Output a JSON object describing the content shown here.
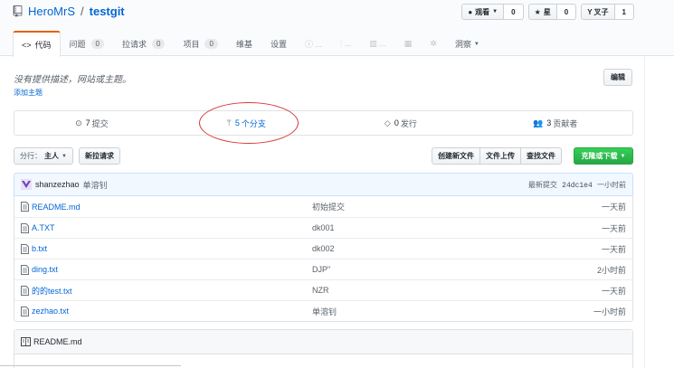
{
  "repo": {
    "owner": "HeroMrS",
    "separator": "/",
    "name": "testgit"
  },
  "actions": [
    {
      "label": "观看",
      "count": "0",
      "icon": "eye-icon"
    },
    {
      "label": "星",
      "count": "0",
      "icon": "star-icon"
    },
    {
      "label": "叉子",
      "count": "1",
      "icon": "fork-icon"
    }
  ],
  "tabs": {
    "code": {
      "label": "代码",
      "icon": "code-icon"
    },
    "issues": {
      "label": "问题",
      "count": "0"
    },
    "pulls": {
      "label": "拉请求",
      "count": "0"
    },
    "projects": {
      "label": "项目",
      "count": "0"
    },
    "wiki": {
      "label": "维基"
    },
    "settings": {
      "label": "设置"
    },
    "insights": {
      "label": "洞察"
    }
  },
  "description": {
    "text": "没有提供描述，网站或主题。",
    "add_topic": "添加主题",
    "edit": "编辑"
  },
  "summary": {
    "commits": {
      "count": "7",
      "label": "提交"
    },
    "branches": {
      "count": "5",
      "label": "个分支"
    },
    "releases": {
      "count": "0",
      "label": "发行"
    },
    "contributors": {
      "count": "3",
      "label": "贡献者"
    }
  },
  "nav": {
    "branch_prefix": "分行：",
    "branch_name": "主人",
    "new_pr": "新拉请求",
    "create_file": "创建新文件",
    "upload": "文件上传",
    "find": "查找文件",
    "clone": "克隆或下载"
  },
  "commit_tease": {
    "author": "shanzezhao",
    "message": "单溶钊",
    "latest_label": "最新提交",
    "sha": "24dc1e4",
    "age": "一小时前"
  },
  "files": [
    {
      "name": "README.md",
      "message": "初始提交",
      "age": "一天前"
    },
    {
      "name": "A.TXT",
      "message": "dk001",
      "age": "一天前"
    },
    {
      "name": "b.txt",
      "message": "dk002",
      "age": "一天前"
    },
    {
      "name": "ding.txt",
      "message": "DJP\"",
      "age": "2小时前"
    },
    {
      "name": "的的test.txt",
      "message": "NZR",
      "age": "一天前"
    },
    {
      "name": "zezhao.txt",
      "message": "单溶钊",
      "age": "一小时前"
    }
  ],
  "readme": {
    "title": "README.md"
  },
  "colors": {
    "link": "#0366d6",
    "accent_tab": "#e36209",
    "clone_green": "#28a745",
    "annotation_red": "#d93a3a"
  }
}
